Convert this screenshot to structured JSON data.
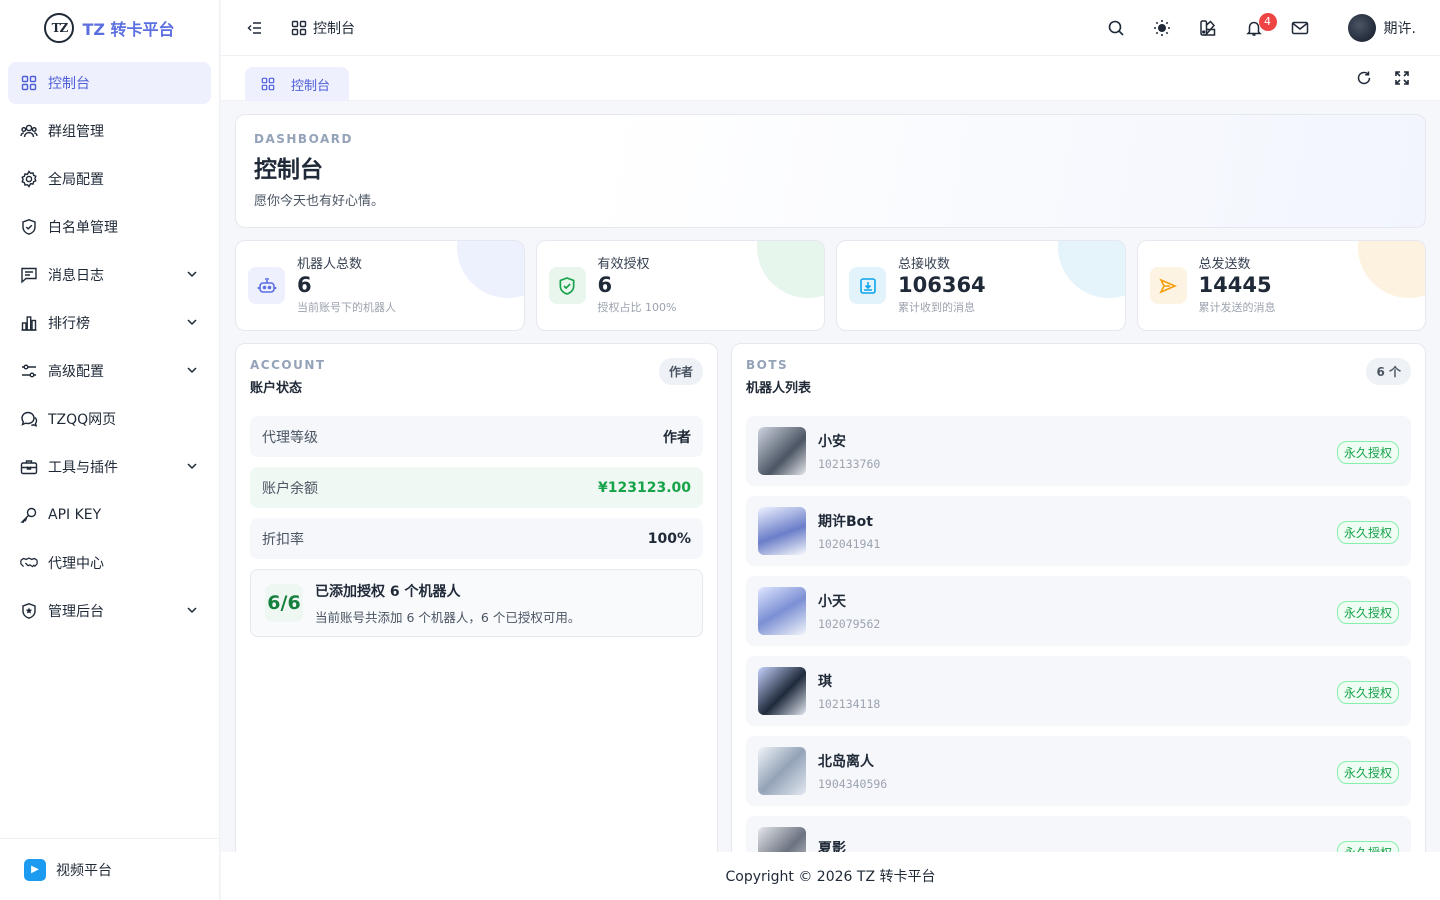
{
  "brand": {
    "logo_text": "TZ",
    "name": "TZ 转卡平台"
  },
  "sidebar": {
    "items": [
      {
        "label": "控制台",
        "icon": "dashboard-grid-icon",
        "active": true
      },
      {
        "label": "群组管理",
        "icon": "users-icon"
      },
      {
        "label": "全局配置",
        "icon": "gear-icon"
      },
      {
        "label": "白名单管理",
        "icon": "shield-check-icon"
      },
      {
        "label": "消息日志",
        "icon": "message-icon",
        "expandable": true
      },
      {
        "label": "排行榜",
        "icon": "bar-chart-icon",
        "expandable": true
      },
      {
        "label": "高级配置",
        "icon": "sliders-icon",
        "expandable": true
      },
      {
        "label": "TZQQ网页",
        "icon": "chat-bubbles-icon"
      },
      {
        "label": "工具与插件",
        "icon": "toolbox-icon",
        "expandable": true
      },
      {
        "label": "API KEY",
        "icon": "key-icon"
      },
      {
        "label": "代理中心",
        "icon": "handshake-icon"
      },
      {
        "label": "管理后台",
        "icon": "star-shield-icon",
        "expandable": true
      }
    ],
    "footer_label": "视频平台"
  },
  "header": {
    "breadcrumb": "控制台",
    "notification_count": "4",
    "user_name": "期许."
  },
  "tabs": [
    {
      "label": "控制台"
    }
  ],
  "hero": {
    "eyebrow": "DASHBOARD",
    "title": "控制台",
    "subtitle": "愿你今天也有好心情。"
  },
  "stats": [
    {
      "label": "机器人总数",
      "value": "6",
      "hint": "当前账号下的机器人",
      "icon": "robot-icon",
      "accent": "#5b6fe0",
      "bg": "#eef0fd"
    },
    {
      "label": "有效授权",
      "value": "6",
      "hint": "授权占比 100%",
      "icon": "shield-check-icon",
      "accent": "#16a34a",
      "bg": "#e8f6ee"
    },
    {
      "label": "总接收数",
      "value": "106364",
      "hint": "累计收到的消息",
      "icon": "inbox-download-icon",
      "accent": "#0ea5e9",
      "bg": "#e3f3fb"
    },
    {
      "label": "总发送数",
      "value": "14445",
      "hint": "累计发送的消息",
      "icon": "send-icon",
      "accent": "#f59e0b",
      "bg": "#fdf3e2"
    }
  ],
  "account": {
    "eyebrow": "ACCOUNT",
    "title": "账户状态",
    "badge": "作者",
    "rows": [
      {
        "key": "代理等级",
        "value": "作者"
      },
      {
        "key": "账户余额",
        "value": "¥123123.00"
      },
      {
        "key": "折扣率",
        "value": "100%"
      }
    ],
    "auth": {
      "ratio": "6/6",
      "title": "已添加授权 6 个机器人",
      "desc": "当前账号共添加 6 个机器人，6 个已授权可用。"
    }
  },
  "bots": {
    "eyebrow": "BOTS",
    "title": "机器人列表",
    "count": "6 个",
    "items": [
      {
        "name": "小安",
        "qq": "102133760",
        "tag": "永久授权"
      },
      {
        "name": "期许Bot",
        "qq": "102041941",
        "tag": "永久授权"
      },
      {
        "name": "小天",
        "qq": "102079562",
        "tag": "永久授权"
      },
      {
        "name": "琪",
        "qq": "102134118",
        "tag": "永久授权"
      },
      {
        "name": "北岛离人",
        "qq": "1904340596",
        "tag": "永久授权"
      },
      {
        "name": "夏影",
        "qq": "",
        "tag": "永久授权"
      }
    ]
  },
  "footer": {
    "copyright": "Copyright © 2026 TZ 转卡平台"
  }
}
